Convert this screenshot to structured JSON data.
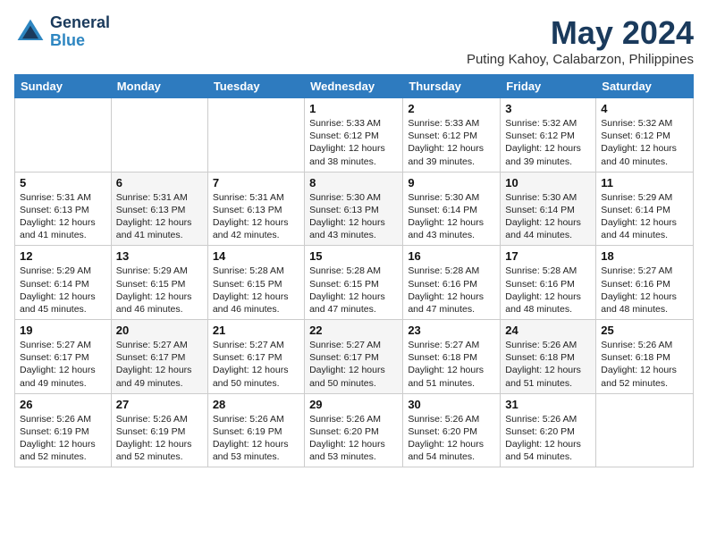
{
  "header": {
    "logo_line1": "General",
    "logo_line2": "Blue",
    "month_title": "May 2024",
    "subtitle": "Puting Kahoy, Calabarzon, Philippines"
  },
  "days_of_week": [
    "Sunday",
    "Monday",
    "Tuesday",
    "Wednesday",
    "Thursday",
    "Friday",
    "Saturday"
  ],
  "weeks": [
    [
      {
        "num": "",
        "info": ""
      },
      {
        "num": "",
        "info": ""
      },
      {
        "num": "",
        "info": ""
      },
      {
        "num": "1",
        "info": "Sunrise: 5:33 AM\nSunset: 6:12 PM\nDaylight: 12 hours\nand 38 minutes."
      },
      {
        "num": "2",
        "info": "Sunrise: 5:33 AM\nSunset: 6:12 PM\nDaylight: 12 hours\nand 39 minutes."
      },
      {
        "num": "3",
        "info": "Sunrise: 5:32 AM\nSunset: 6:12 PM\nDaylight: 12 hours\nand 39 minutes."
      },
      {
        "num": "4",
        "info": "Sunrise: 5:32 AM\nSunset: 6:12 PM\nDaylight: 12 hours\nand 40 minutes."
      }
    ],
    [
      {
        "num": "5",
        "info": "Sunrise: 5:31 AM\nSunset: 6:13 PM\nDaylight: 12 hours\nand 41 minutes."
      },
      {
        "num": "6",
        "info": "Sunrise: 5:31 AM\nSunset: 6:13 PM\nDaylight: 12 hours\nand 41 minutes."
      },
      {
        "num": "7",
        "info": "Sunrise: 5:31 AM\nSunset: 6:13 PM\nDaylight: 12 hours\nand 42 minutes."
      },
      {
        "num": "8",
        "info": "Sunrise: 5:30 AM\nSunset: 6:13 PM\nDaylight: 12 hours\nand 43 minutes."
      },
      {
        "num": "9",
        "info": "Sunrise: 5:30 AM\nSunset: 6:14 PM\nDaylight: 12 hours\nand 43 minutes."
      },
      {
        "num": "10",
        "info": "Sunrise: 5:30 AM\nSunset: 6:14 PM\nDaylight: 12 hours\nand 44 minutes."
      },
      {
        "num": "11",
        "info": "Sunrise: 5:29 AM\nSunset: 6:14 PM\nDaylight: 12 hours\nand 44 minutes."
      }
    ],
    [
      {
        "num": "12",
        "info": "Sunrise: 5:29 AM\nSunset: 6:14 PM\nDaylight: 12 hours\nand 45 minutes."
      },
      {
        "num": "13",
        "info": "Sunrise: 5:29 AM\nSunset: 6:15 PM\nDaylight: 12 hours\nand 46 minutes."
      },
      {
        "num": "14",
        "info": "Sunrise: 5:28 AM\nSunset: 6:15 PM\nDaylight: 12 hours\nand 46 minutes."
      },
      {
        "num": "15",
        "info": "Sunrise: 5:28 AM\nSunset: 6:15 PM\nDaylight: 12 hours\nand 47 minutes."
      },
      {
        "num": "16",
        "info": "Sunrise: 5:28 AM\nSunset: 6:16 PM\nDaylight: 12 hours\nand 47 minutes."
      },
      {
        "num": "17",
        "info": "Sunrise: 5:28 AM\nSunset: 6:16 PM\nDaylight: 12 hours\nand 48 minutes."
      },
      {
        "num": "18",
        "info": "Sunrise: 5:27 AM\nSunset: 6:16 PM\nDaylight: 12 hours\nand 48 minutes."
      }
    ],
    [
      {
        "num": "19",
        "info": "Sunrise: 5:27 AM\nSunset: 6:17 PM\nDaylight: 12 hours\nand 49 minutes."
      },
      {
        "num": "20",
        "info": "Sunrise: 5:27 AM\nSunset: 6:17 PM\nDaylight: 12 hours\nand 49 minutes."
      },
      {
        "num": "21",
        "info": "Sunrise: 5:27 AM\nSunset: 6:17 PM\nDaylight: 12 hours\nand 50 minutes."
      },
      {
        "num": "22",
        "info": "Sunrise: 5:27 AM\nSunset: 6:17 PM\nDaylight: 12 hours\nand 50 minutes."
      },
      {
        "num": "23",
        "info": "Sunrise: 5:27 AM\nSunset: 6:18 PM\nDaylight: 12 hours\nand 51 minutes."
      },
      {
        "num": "24",
        "info": "Sunrise: 5:26 AM\nSunset: 6:18 PM\nDaylight: 12 hours\nand 51 minutes."
      },
      {
        "num": "25",
        "info": "Sunrise: 5:26 AM\nSunset: 6:18 PM\nDaylight: 12 hours\nand 52 minutes."
      }
    ],
    [
      {
        "num": "26",
        "info": "Sunrise: 5:26 AM\nSunset: 6:19 PM\nDaylight: 12 hours\nand 52 minutes."
      },
      {
        "num": "27",
        "info": "Sunrise: 5:26 AM\nSunset: 6:19 PM\nDaylight: 12 hours\nand 52 minutes."
      },
      {
        "num": "28",
        "info": "Sunrise: 5:26 AM\nSunset: 6:19 PM\nDaylight: 12 hours\nand 53 minutes."
      },
      {
        "num": "29",
        "info": "Sunrise: 5:26 AM\nSunset: 6:20 PM\nDaylight: 12 hours\nand 53 minutes."
      },
      {
        "num": "30",
        "info": "Sunrise: 5:26 AM\nSunset: 6:20 PM\nDaylight: 12 hours\nand 54 minutes."
      },
      {
        "num": "31",
        "info": "Sunrise: 5:26 AM\nSunset: 6:20 PM\nDaylight: 12 hours\nand 54 minutes."
      },
      {
        "num": "",
        "info": ""
      }
    ]
  ]
}
